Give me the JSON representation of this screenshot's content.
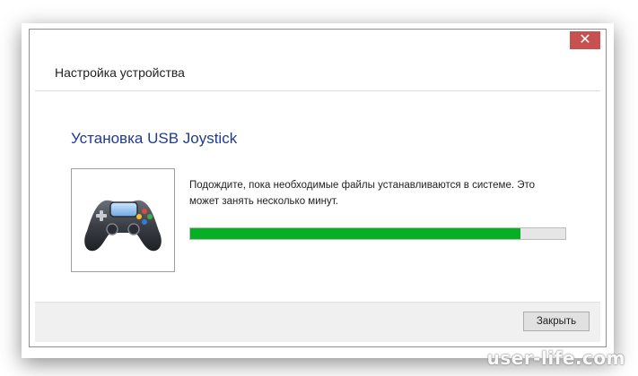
{
  "window": {
    "title": "Настройка устройства",
    "close_glyph": "✕"
  },
  "install": {
    "heading": "Установка USB  Joystick",
    "message": "Подождите, пока необходимые файлы устанавливаются в системе. Это может занять несколько минут.",
    "progress_fraction": 0.88,
    "device_icon": "gamepad-icon"
  },
  "footer": {
    "close_label": "Закрыть"
  },
  "watermark": "user-life.com",
  "colors": {
    "heading": "#1f3a93",
    "progress": "#06b025",
    "close_button": "#c75050"
  }
}
